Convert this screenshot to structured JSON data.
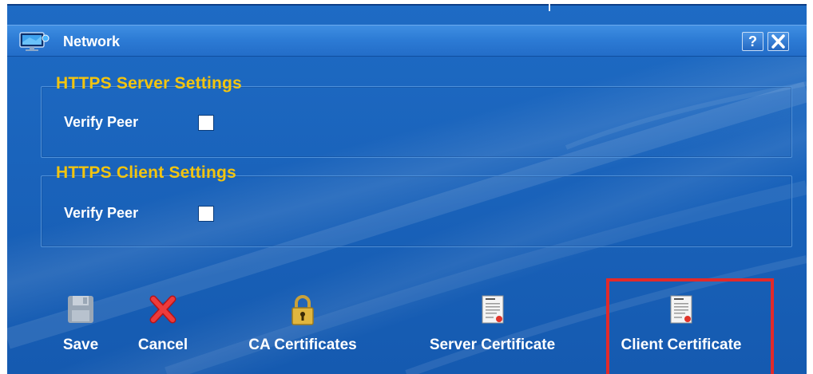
{
  "window": {
    "title": "Network",
    "help_label": "?",
    "close_label": "✕",
    "app_icon": "monitor-icon"
  },
  "server_settings": {
    "title": "HTTPS Server Settings",
    "verify_peer_label": "Verify Peer",
    "verify_peer_checked": false
  },
  "client_settings": {
    "title": "HTTPS Client Settings",
    "verify_peer_label": "Verify Peer",
    "verify_peer_checked": false
  },
  "toolbar": {
    "save": {
      "label": "Save",
      "icon": "floppy-disk-icon"
    },
    "cancel": {
      "label": "Cancel",
      "icon": "red-x-icon"
    },
    "ca_certificates": {
      "label": "CA Certificates",
      "icon": "padlock-icon"
    },
    "server_certificate": {
      "label": "Server Certificate",
      "icon": "certificate-icon"
    },
    "client_certificate": {
      "label": "Client Certificate",
      "icon": "certificate-icon",
      "highlighted": true
    }
  },
  "colors": {
    "background": "#1a63bb",
    "group_title": "#f2c40f",
    "text": "#ffffff",
    "highlight": "#e22a2a"
  }
}
